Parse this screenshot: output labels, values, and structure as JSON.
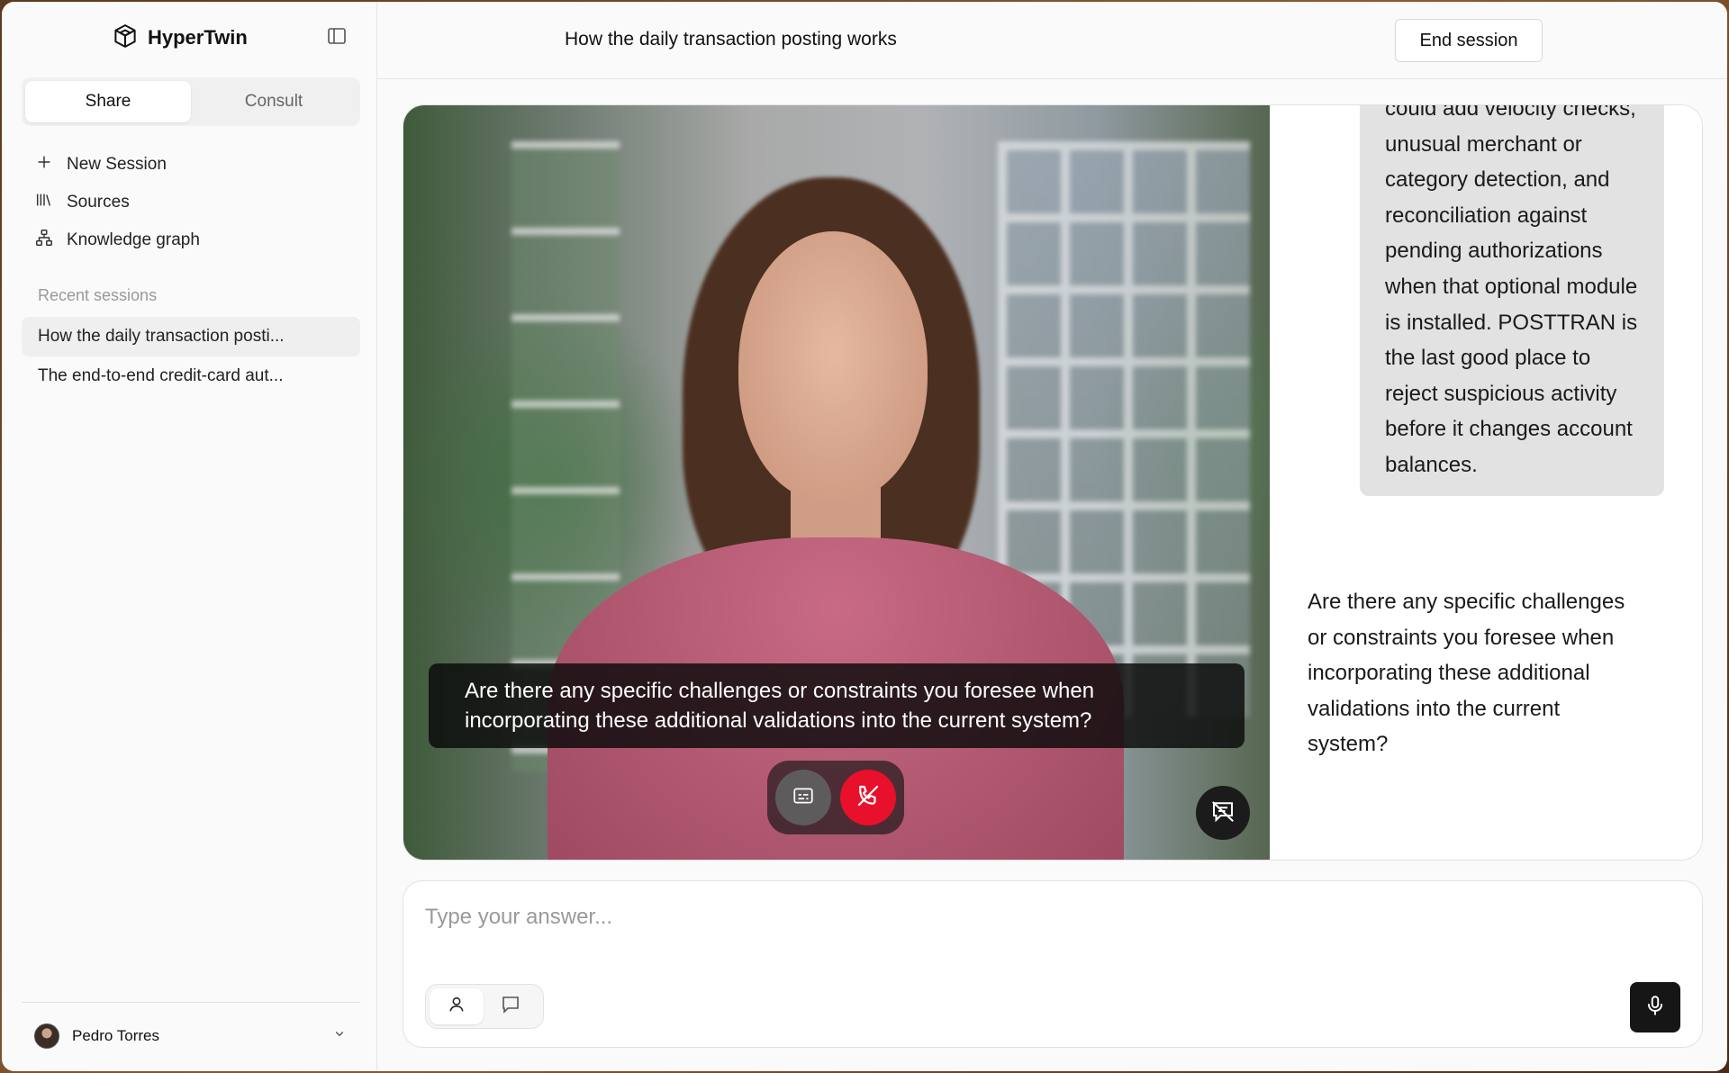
{
  "app": {
    "name": "HyperTwin"
  },
  "sidebar": {
    "tabs": [
      {
        "label": "Share",
        "active": true
      },
      {
        "label": "Consult",
        "active": false
      }
    ],
    "nav": [
      {
        "label": "New Session",
        "icon": "plus-icon"
      },
      {
        "label": "Sources",
        "icon": "library-icon"
      },
      {
        "label": "Knowledge graph",
        "icon": "graph-icon"
      }
    ],
    "recent_label": "Recent sessions",
    "recent": [
      {
        "label": "How the daily transaction posti...",
        "active": true
      },
      {
        "label": "The end-to-end credit-card aut...",
        "active": false
      }
    ],
    "user": {
      "name": "Pedro Torres"
    }
  },
  "header": {
    "title": "How the daily transaction posting works",
    "end_session_label": "End session"
  },
  "video": {
    "caption": "Are there any specific challenges or constraints you foresee when incorporating these additional validations into the current system?"
  },
  "chat": {
    "user_message": "could add velocity checks, unusual merchant or category detection, and reconciliation against pending authorizations when that optional module is installed. POSTTRAN is the last good place to reject suspicious activity before it changes account balances.",
    "assistant_message": "Are there any specific challenges or constraints you foresee when incorporating these additional validations into the current system?"
  },
  "composer": {
    "placeholder": "Type your answer...",
    "value": ""
  },
  "colors": {
    "hangup": "#e8102a",
    "user_bubble": "#e2e2e2",
    "mic_button": "#161616"
  }
}
